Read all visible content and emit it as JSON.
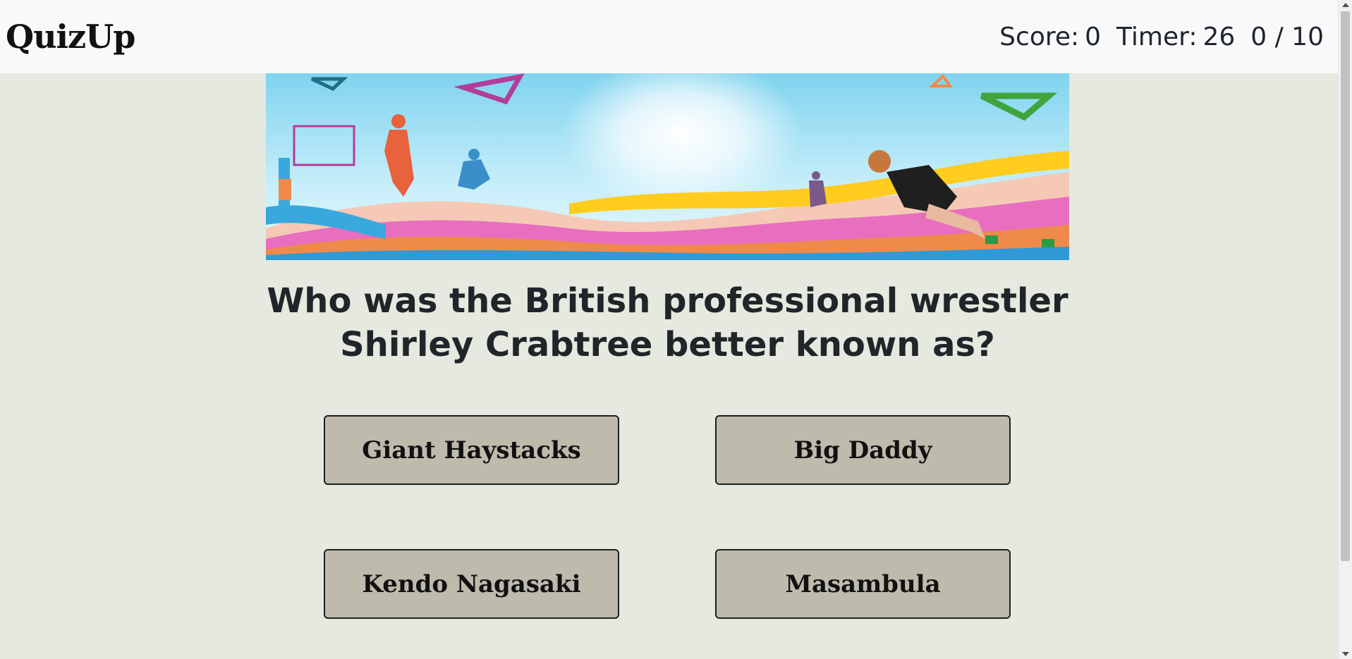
{
  "app": {
    "brand": "QuizUp"
  },
  "stats": {
    "score_label": "Score:",
    "score_value": "0",
    "timer_label": "Timer:",
    "timer_value": "26",
    "progress": "0 / 10"
  },
  "banner": {
    "icon": "sports-banner-image"
  },
  "question": {
    "text": "Who was the British professional wrestler Shirley Crabtree better known as?"
  },
  "answers": [
    {
      "label": "Giant Haystacks"
    },
    {
      "label": "Big Daddy"
    },
    {
      "label": "Kendo Nagasaki"
    },
    {
      "label": "Masambula"
    }
  ],
  "colors": {
    "background": "#e5e9df",
    "navbar": "#f8f9fa",
    "answer_button": "#bebaac",
    "text": "#212529"
  }
}
